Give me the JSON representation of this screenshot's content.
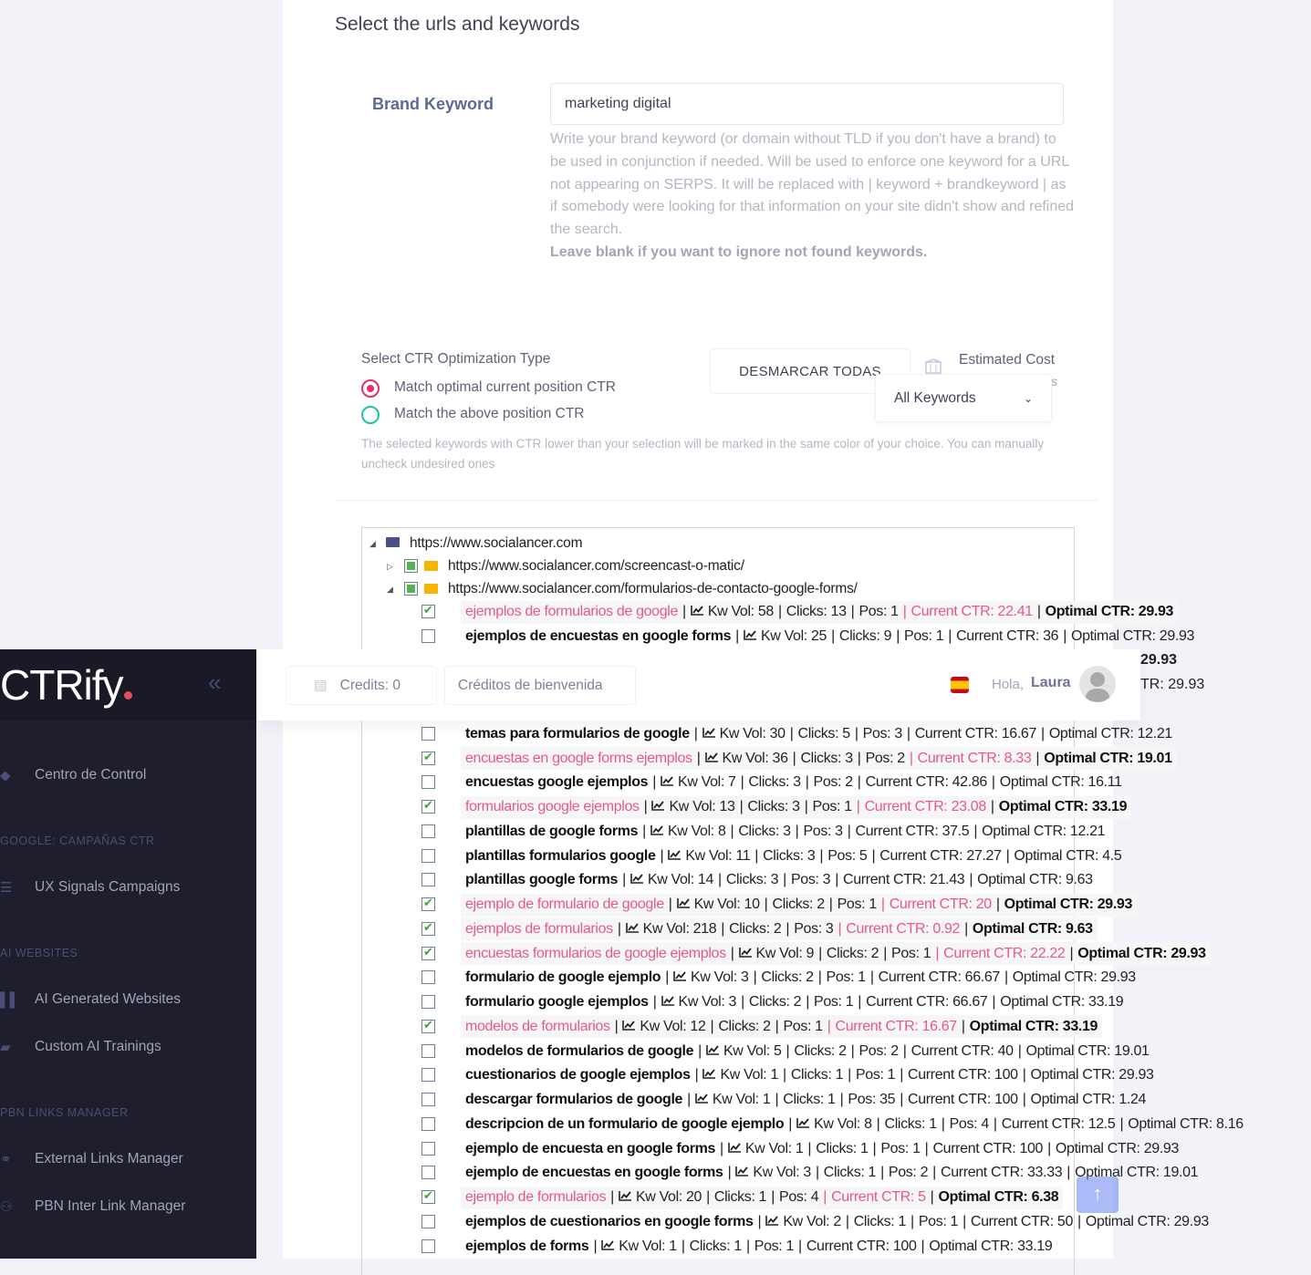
{
  "page": {
    "title": "Select the urls and keywords"
  },
  "brand": {
    "label": "Brand Keyword",
    "value": "marketing digital",
    "help": "Write your brand keyword (or domain without TLD if you don't have a brand) to be used in conjunction if needed. Will be used to enforce one keyword for a URL not appearing on SERPS. It will be replaced with | keyword + brandkeyword | as if somebody were looking for that information on your site didn't show and refined the search.",
    "help_bold": "Leave blank if you want to ignore not found keywords."
  },
  "optimization": {
    "title": "Select CTR Optimization Type",
    "options": [
      {
        "label": "Match optimal current position CTR",
        "selected": true,
        "color": "#e4306d"
      },
      {
        "label": "Match the above position CTR",
        "selected": false,
        "color": "#1bc5a0"
      }
    ],
    "note": "The selected keywords with CTR lower than your selection will be marked in the same color of your choice. You can manually uncheck undesired ones"
  },
  "toolbar": {
    "unmark_all": "DESMARCAR TODAS",
    "estimated_cost": "Estimated Cost",
    "estimated_cost_suffix": "s",
    "filter_selected": "All Keywords"
  },
  "tree": {
    "root": "https://www.socialancer.com",
    "children": [
      {
        "url": "https://www.socialancer.com/screencast-o-matic/",
        "expanded": false
      },
      {
        "url": "https://www.socialancer.com/formularios-de-contacto-google-forms/",
        "expanded": true
      }
    ],
    "labels": {
      "kwvol": "Kw Vol:",
      "clicks": "Clicks:",
      "pos": "Pos:",
      "current": "Current CTR:",
      "optimal": "Optimal CTR:"
    },
    "highlight_color": "#e8578a",
    "top_rows": [
      {
        "kw": "ejemplos de formularios de google",
        "vol": "58",
        "clicks": "13",
        "pos": "1",
        "cur": "22.41",
        "opt": "29.93",
        "checked": true
      },
      {
        "kw": "ejemplos de encuestas en google forms",
        "vol": "25",
        "clicks": "9",
        "pos": "1",
        "cur": "36",
        "opt": "29.93",
        "checked": false
      }
    ],
    "partial_rows": [
      {
        "tail": "29.93",
        "bold": true
      },
      {
        "tail": "TR: 29.93",
        "bold": false
      }
    ],
    "rows": [
      {
        "kw": "temas para formularios de google",
        "vol": "30",
        "clicks": "5",
        "pos": "3",
        "cur": "16.67",
        "opt": "12.21",
        "checked": false
      },
      {
        "kw": "encuestas en google forms ejemplos",
        "vol": "36",
        "clicks": "3",
        "pos": "2",
        "cur": "8.33",
        "opt": "19.01",
        "checked": true
      },
      {
        "kw": "encuestas google ejemplos",
        "vol": "7",
        "clicks": "3",
        "pos": "2",
        "cur": "42.86",
        "opt": "16.11",
        "checked": false
      },
      {
        "kw": "formularios google ejemplos",
        "vol": "13",
        "clicks": "3",
        "pos": "1",
        "cur": "23.08",
        "opt": "33.19",
        "checked": true
      },
      {
        "kw": "plantillas de google forms",
        "vol": "8",
        "clicks": "3",
        "pos": "3",
        "cur": "37.5",
        "opt": "12.21",
        "checked": false
      },
      {
        "kw": "plantillas formularios google",
        "vol": "11",
        "clicks": "3",
        "pos": "5",
        "cur": "27.27",
        "opt": "4.5",
        "checked": false
      },
      {
        "kw": "plantillas google forms",
        "vol": "14",
        "clicks": "3",
        "pos": "3",
        "cur": "21.43",
        "opt": "9.63",
        "checked": false
      },
      {
        "kw": "ejemplo de formulario de google",
        "vol": "10",
        "clicks": "2",
        "pos": "1",
        "cur": "20",
        "opt": "29.93",
        "checked": true
      },
      {
        "kw": "ejemplos de formularios",
        "vol": "218",
        "clicks": "2",
        "pos": "3",
        "cur": "0.92",
        "opt": "9.63",
        "checked": true
      },
      {
        "kw": "encuestas formularios de google ejemplos",
        "vol": "9",
        "clicks": "2",
        "pos": "1",
        "cur": "22.22",
        "opt": "29.93",
        "checked": true
      },
      {
        "kw": "formulario de google ejemplo",
        "vol": "3",
        "clicks": "2",
        "pos": "1",
        "cur": "66.67",
        "opt": "29.93",
        "checked": false
      },
      {
        "kw": "formulario google ejemplos",
        "vol": "3",
        "clicks": "2",
        "pos": "1",
        "cur": "66.67",
        "opt": "33.19",
        "checked": false
      },
      {
        "kw": "modelos de formularios",
        "vol": "12",
        "clicks": "2",
        "pos": "1",
        "cur": "16.67",
        "opt": "33.19",
        "checked": true
      },
      {
        "kw": "modelos de formularios de google",
        "vol": "5",
        "clicks": "2",
        "pos": "2",
        "cur": "40",
        "opt": "19.01",
        "checked": false
      },
      {
        "kw": "cuestionarios de google ejemplos",
        "vol": "1",
        "clicks": "1",
        "pos": "1",
        "cur": "100",
        "opt": "29.93",
        "checked": false
      },
      {
        "kw": "descargar formularios de google",
        "vol": "1",
        "clicks": "1",
        "pos": "35",
        "cur": "100",
        "opt": "1.24",
        "checked": false
      },
      {
        "kw": "descripcion de un formulario de google ejemplo",
        "vol": "8",
        "clicks": "1",
        "pos": "4",
        "cur": "12.5",
        "opt": "8.16",
        "checked": false
      },
      {
        "kw": "ejemplo de encuesta en google forms",
        "vol": "1",
        "clicks": "1",
        "pos": "1",
        "cur": "100",
        "opt": "29.93",
        "checked": false
      },
      {
        "kw": "ejemplo de encuestas en google forms",
        "vol": "3",
        "clicks": "1",
        "pos": "2",
        "cur": "33.33",
        "opt": "19.01",
        "checked": false
      },
      {
        "kw": "ejemplo de formularios",
        "vol": "20",
        "clicks": "1",
        "pos": "4",
        "cur": "5",
        "opt": "6.38",
        "checked": true
      },
      {
        "kw": "ejemplos de cuestionarios en google forms",
        "vol": "2",
        "clicks": "1",
        "pos": "1",
        "cur": "50",
        "opt": "29.93",
        "checked": false
      },
      {
        "kw": "ejemplos de forms",
        "vol": "1",
        "clicks": "1",
        "pos": "1",
        "cur": "100",
        "opt": "33.19",
        "checked": false
      }
    ]
  },
  "sidebar": {
    "logo": "CTRify",
    "items": [
      {
        "type": "item",
        "label": "Centro de Control",
        "icon": "diamond-icon"
      },
      {
        "type": "section",
        "label": "GOOGLE: CAMPAÑAS CTR"
      },
      {
        "type": "item",
        "label": "UX Signals Campaigns",
        "icon": "list-icon"
      },
      {
        "type": "section",
        "label": "AI WEBSITES"
      },
      {
        "type": "item",
        "label": "AI Generated Websites",
        "icon": "columns-icon"
      },
      {
        "type": "item",
        "label": "Custom AI Trainings",
        "icon": "chat-icon"
      },
      {
        "type": "section",
        "label": "PBN LINKS MANAGER"
      },
      {
        "type": "item",
        "label": "External Links Manager",
        "icon": "link-icon"
      },
      {
        "type": "item",
        "label": "PBN Inter Link Manager",
        "icon": "network-icon"
      }
    ]
  },
  "header": {
    "credits": "Credits: 0",
    "welcome_credits": "Créditos de bienvenida",
    "greeting": "Hola,",
    "user": "Laura",
    "language": "es"
  }
}
